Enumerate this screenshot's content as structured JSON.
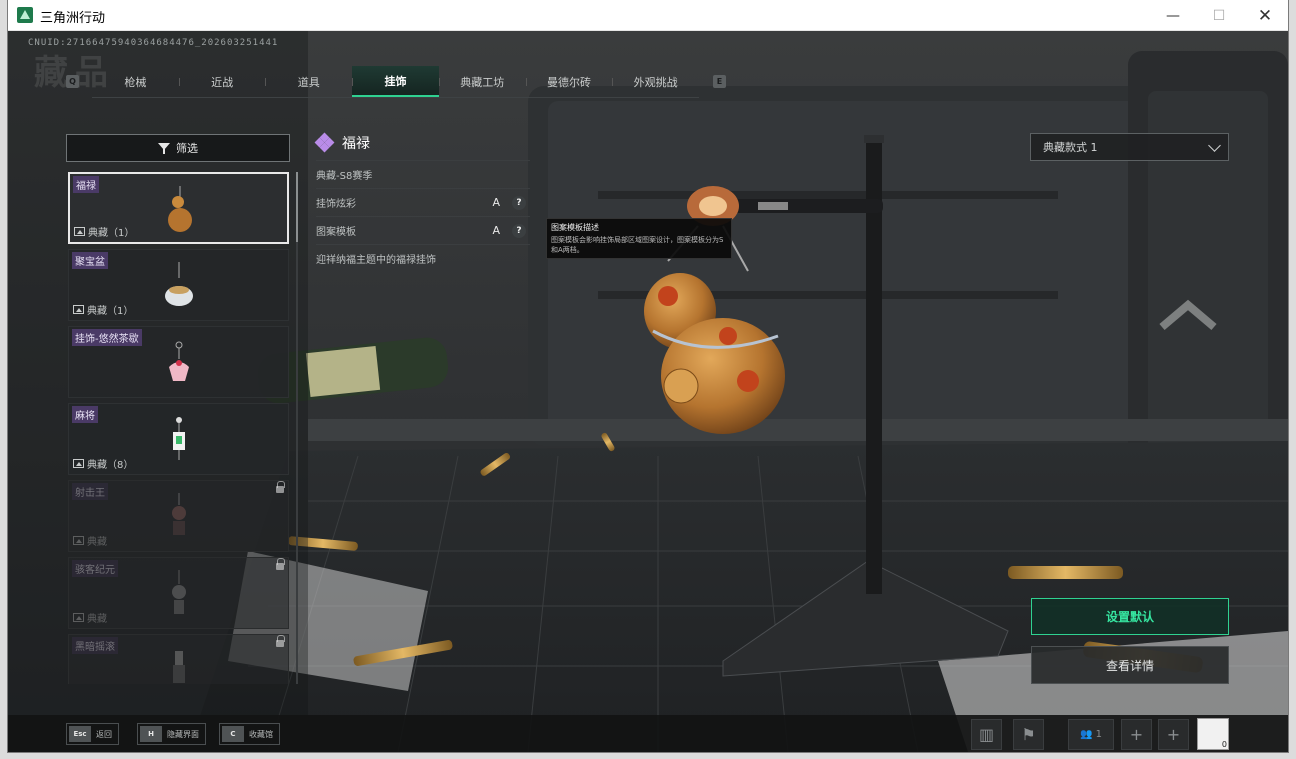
{
  "window": {
    "title": "三角洲行动",
    "min": "—",
    "max": "☐",
    "close": "✕"
  },
  "cnuid": "CNUID:27166475940364684476_202603251441",
  "page_heading": "藏品",
  "tabs": [
    {
      "label": "枪械"
    },
    {
      "label": "近战"
    },
    {
      "label": "道具"
    },
    {
      "label": "挂饰"
    },
    {
      "label": "典藏工坊"
    },
    {
      "label": "曼德尔砖"
    },
    {
      "label": "外观挑战"
    }
  ],
  "tab_keys": {
    "left": "Q",
    "right": "E"
  },
  "filter": {
    "label": "筛选"
  },
  "items": [
    {
      "name": "福禄",
      "collection": "典藏（1）"
    },
    {
      "name": "聚宝盆",
      "collection": "典藏（1）"
    },
    {
      "name": "挂饰-悠然茶歇",
      "collection": ""
    },
    {
      "name": "麻将",
      "collection": "典藏（8）"
    },
    {
      "name": "射击王",
      "collection": "典藏"
    },
    {
      "name": "骇客纪元",
      "collection": "典藏"
    },
    {
      "name": "黑暗摇滚",
      "collection": ""
    }
  ],
  "detail": {
    "title": "福禄",
    "season": "典藏-S8赛季",
    "rows": [
      {
        "label": "挂饰炫彩",
        "grade": "A",
        "help": "?"
      },
      {
        "label": "图案模板",
        "grade": "A",
        "help": "?"
      }
    ],
    "description": "迎祥纳福主题中的福禄挂饰"
  },
  "tooltip": {
    "title": "图案模板描述",
    "body": "图案模板会影响挂饰局部区域图案设计，图案模板分为S和A两档。"
  },
  "dropdown": {
    "value": "典藏款式 1"
  },
  "actions": {
    "set_default": "设置默认",
    "view_details": "查看详情"
  },
  "hints": [
    {
      "key": "Esc",
      "label": "返回"
    },
    {
      "key": "H",
      "label": "隐藏界面"
    },
    {
      "key": "C",
      "label": "收藏馆"
    }
  ],
  "social": {
    "team_count": "1",
    "avatar_badge": "0"
  },
  "colors": {
    "accent": "#2fd291",
    "rarity": "#4a3a66",
    "gem": "#b98ce8"
  }
}
